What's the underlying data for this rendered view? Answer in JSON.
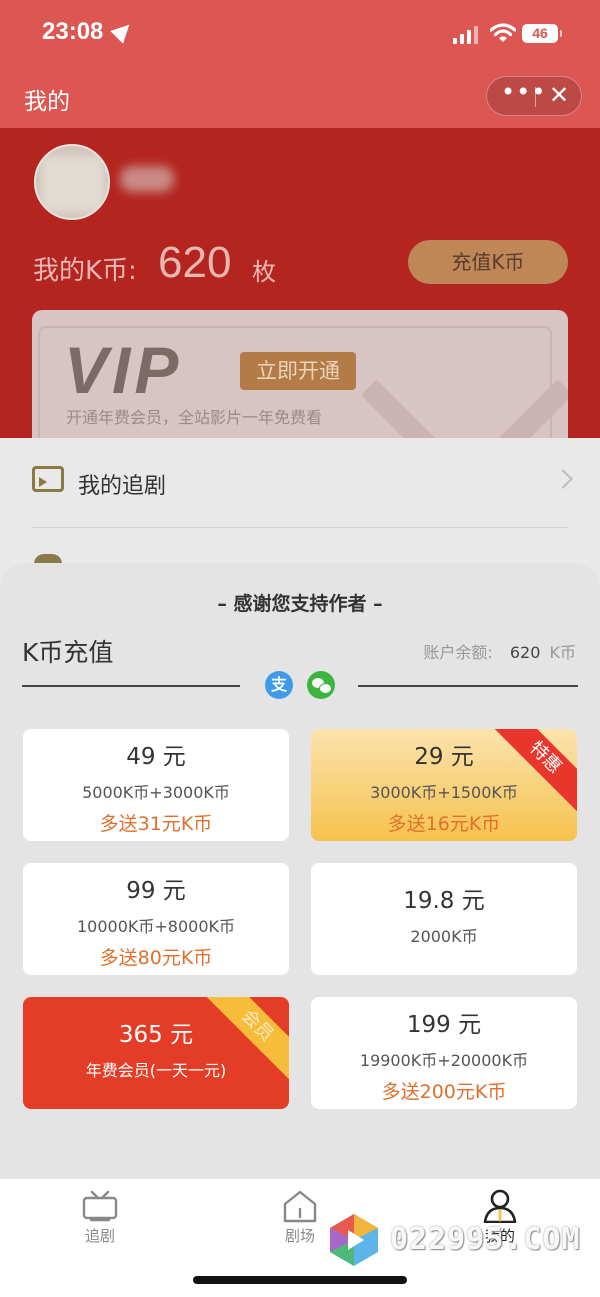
{
  "status_bar": {
    "time": "23:08",
    "battery": "46"
  },
  "title_bar": {
    "title": "我的",
    "more_icon": "•••",
    "close_icon": "✕"
  },
  "profile": {
    "kcoin_label": "我的K币:",
    "kcoin_value": "620",
    "kcoin_unit": "枚",
    "recharge_button": "充值K币"
  },
  "vip_card": {
    "logo": "VIP",
    "open_button": "立即开通",
    "description": "开通年费会员，全站影片一年免费看"
  },
  "menu": {
    "items": [
      {
        "label": "我的追剧"
      }
    ]
  },
  "sheet": {
    "heading": "– 感谢您支持作者 –",
    "section_title": "K币充值",
    "balance_label": "账户余额:",
    "balance_value": "620",
    "balance_unit": "K币",
    "payment_icons": {
      "alipay": "支",
      "wechat": "wechat-icon"
    },
    "packages": [
      {
        "price": "49 元",
        "detail": "5000K币+3000K币",
        "bonus": "多送31元K币",
        "style": "plain"
      },
      {
        "price": "29 元",
        "detail": "3000K币+1500K币",
        "bonus": "多送16元K币",
        "style": "featured",
        "tag": "特惠"
      },
      {
        "price": "99 元",
        "detail": "10000K币+8000K币",
        "bonus": "多送80元K币",
        "style": "plain"
      },
      {
        "price": "19.8 元",
        "detail": "2000K币",
        "bonus": "",
        "style": "plain"
      },
      {
        "price": "365 元",
        "detail": "年费会员(一天一元)",
        "bonus": "",
        "style": "member",
        "tag": "会员"
      },
      {
        "price": "199 元",
        "detail": "19900K币+20000K币",
        "bonus": "多送200元K币",
        "style": "plain"
      }
    ]
  },
  "tab_bar": {
    "tabs": [
      {
        "label": "追剧",
        "icon": "tv-icon"
      },
      {
        "label": "剧场",
        "icon": "home-icon"
      },
      {
        "label": "我的",
        "icon": "person-icon",
        "active": true
      }
    ]
  },
  "watermark": {
    "text": "022995.COM"
  },
  "colors": {
    "header": "#dc5652",
    "accent_orange": "#e0702e",
    "member_red": "#e43d27",
    "featured_gold": "#f5c24d"
  }
}
